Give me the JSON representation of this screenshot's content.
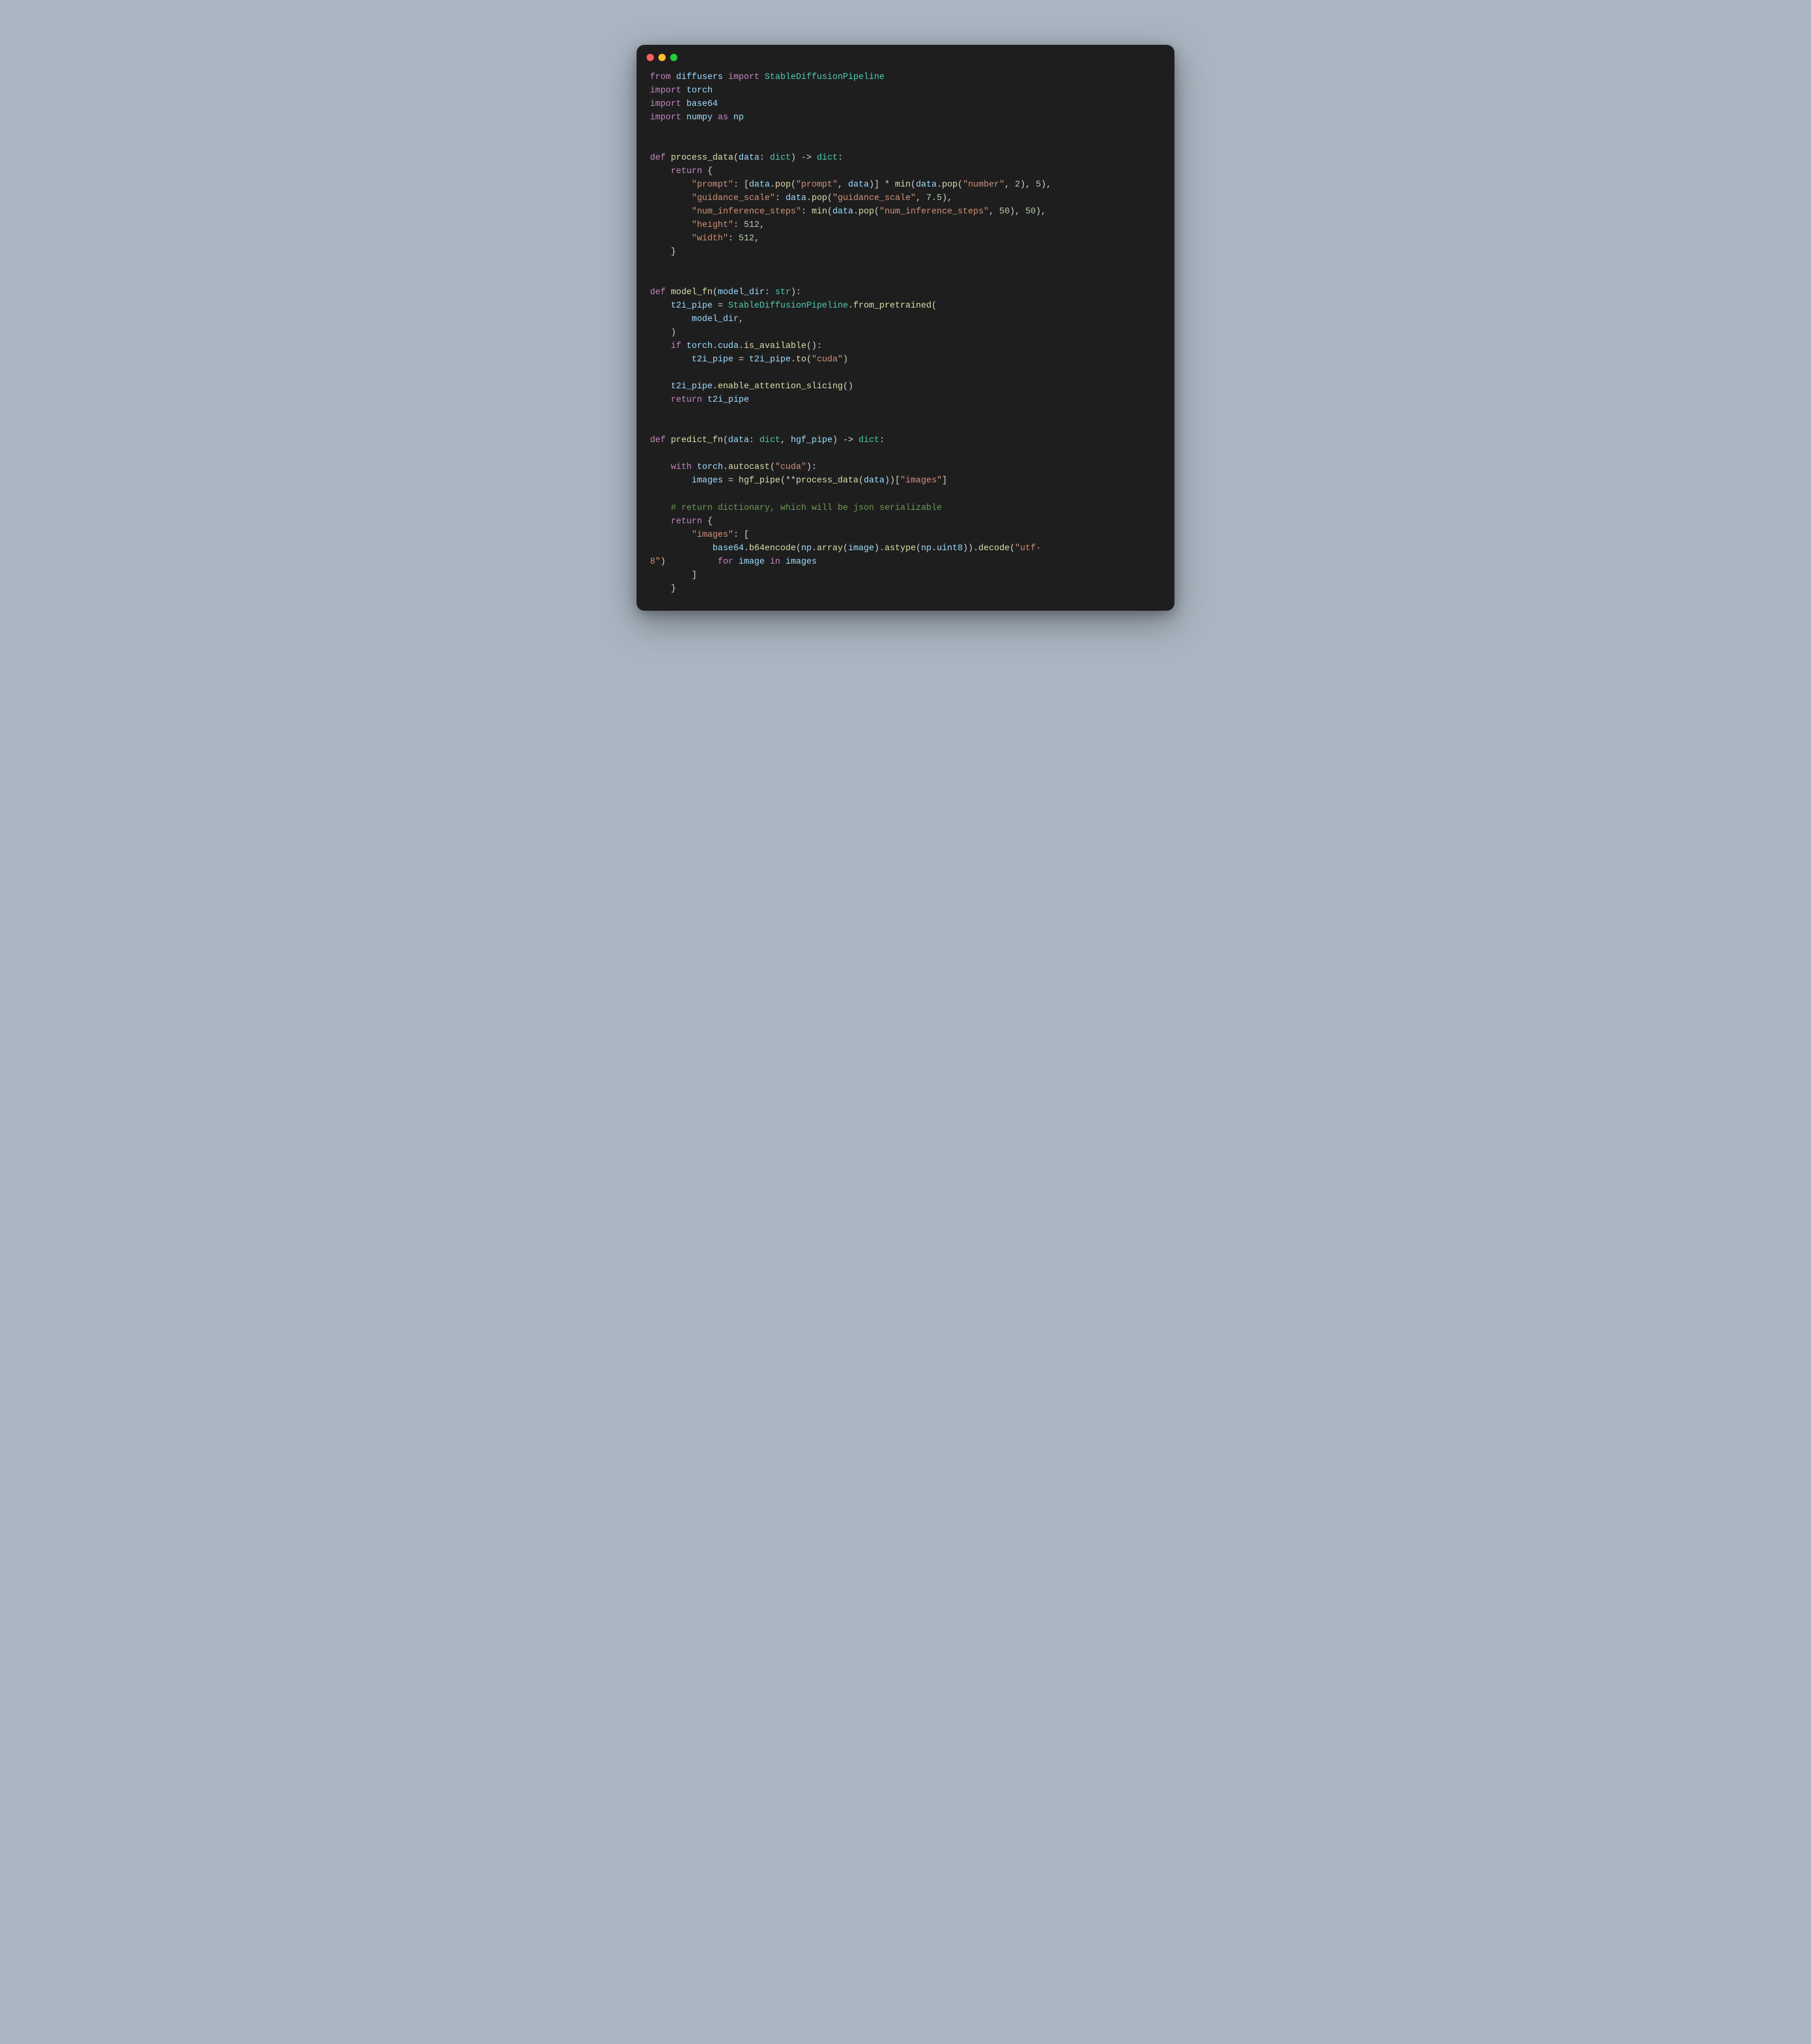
{
  "code_lines": [
    {
      "kind": "line",
      "tokens": [
        {
          "t": "from ",
          "c": "kw"
        },
        {
          "t": "diffusers ",
          "c": "var"
        },
        {
          "t": "import ",
          "c": "kw"
        },
        {
          "t": "StableDiffusionPipeline",
          "c": "cls"
        }
      ]
    },
    {
      "kind": "line",
      "tokens": [
        {
          "t": "import ",
          "c": "kw"
        },
        {
          "t": "torch",
          "c": "var"
        }
      ]
    },
    {
      "kind": "line",
      "tokens": [
        {
          "t": "import ",
          "c": "kw"
        },
        {
          "t": "base64",
          "c": "var"
        }
      ]
    },
    {
      "kind": "line",
      "tokens": [
        {
          "t": "import ",
          "c": "kw"
        },
        {
          "t": "numpy ",
          "c": "var"
        },
        {
          "t": "as ",
          "c": "kw"
        },
        {
          "t": "np",
          "c": "var"
        }
      ]
    },
    {
      "kind": "blank"
    },
    {
      "kind": "blank"
    },
    {
      "kind": "line",
      "tokens": [
        {
          "t": "def ",
          "c": "kw"
        },
        {
          "t": "process_data",
          "c": "fn"
        },
        {
          "t": "(",
          "c": "op"
        },
        {
          "t": "data",
          "c": "var"
        },
        {
          "t": ": ",
          "c": "op"
        },
        {
          "t": "dict",
          "c": "cls"
        },
        {
          "t": ") -> ",
          "c": "op"
        },
        {
          "t": "dict",
          "c": "cls"
        },
        {
          "t": ":",
          "c": "op"
        }
      ]
    },
    {
      "kind": "line",
      "tokens": [
        {
          "t": "    ",
          "c": "op"
        },
        {
          "t": "return ",
          "c": "kw"
        },
        {
          "t": "{",
          "c": "op"
        }
      ]
    },
    {
      "kind": "line",
      "tokens": [
        {
          "t": "        ",
          "c": "op"
        },
        {
          "t": "\"prompt\"",
          "c": "str"
        },
        {
          "t": ": [",
          "c": "op"
        },
        {
          "t": "data",
          "c": "var"
        },
        {
          "t": ".",
          "c": "op"
        },
        {
          "t": "pop",
          "c": "fn"
        },
        {
          "t": "(",
          "c": "op"
        },
        {
          "t": "\"prompt\"",
          "c": "str"
        },
        {
          "t": ", ",
          "c": "op"
        },
        {
          "t": "data",
          "c": "var"
        },
        {
          "t": ")] * ",
          "c": "op"
        },
        {
          "t": "min",
          "c": "fn"
        },
        {
          "t": "(",
          "c": "op"
        },
        {
          "t": "data",
          "c": "var"
        },
        {
          "t": ".",
          "c": "op"
        },
        {
          "t": "pop",
          "c": "fn"
        },
        {
          "t": "(",
          "c": "op"
        },
        {
          "t": "\"number\"",
          "c": "str"
        },
        {
          "t": ", ",
          "c": "op"
        },
        {
          "t": "2",
          "c": "num"
        },
        {
          "t": "), ",
          "c": "op"
        },
        {
          "t": "5",
          "c": "num"
        },
        {
          "t": "),",
          "c": "op"
        }
      ]
    },
    {
      "kind": "line",
      "tokens": [
        {
          "t": "        ",
          "c": "op"
        },
        {
          "t": "\"guidance_scale\"",
          "c": "str"
        },
        {
          "t": ": ",
          "c": "op"
        },
        {
          "t": "data",
          "c": "var"
        },
        {
          "t": ".",
          "c": "op"
        },
        {
          "t": "pop",
          "c": "fn"
        },
        {
          "t": "(",
          "c": "op"
        },
        {
          "t": "\"guidance_scale\"",
          "c": "str"
        },
        {
          "t": ", ",
          "c": "op"
        },
        {
          "t": "7.5",
          "c": "num"
        },
        {
          "t": "),",
          "c": "op"
        }
      ]
    },
    {
      "kind": "line",
      "tokens": [
        {
          "t": "        ",
          "c": "op"
        },
        {
          "t": "\"num_inference_steps\"",
          "c": "str"
        },
        {
          "t": ": ",
          "c": "op"
        },
        {
          "t": "min",
          "c": "fn"
        },
        {
          "t": "(",
          "c": "op"
        },
        {
          "t": "data",
          "c": "var"
        },
        {
          "t": ".",
          "c": "op"
        },
        {
          "t": "pop",
          "c": "fn"
        },
        {
          "t": "(",
          "c": "op"
        },
        {
          "t": "\"num_inference_steps\"",
          "c": "str"
        },
        {
          "t": ", ",
          "c": "op"
        },
        {
          "t": "50",
          "c": "num"
        },
        {
          "t": "), ",
          "c": "op"
        },
        {
          "t": "50",
          "c": "num"
        },
        {
          "t": "),",
          "c": "op"
        }
      ]
    },
    {
      "kind": "line",
      "tokens": [
        {
          "t": "        ",
          "c": "op"
        },
        {
          "t": "\"height\"",
          "c": "str"
        },
        {
          "t": ": ",
          "c": "op"
        },
        {
          "t": "512",
          "c": "num"
        },
        {
          "t": ",",
          "c": "op"
        }
      ]
    },
    {
      "kind": "line",
      "tokens": [
        {
          "t": "        ",
          "c": "op"
        },
        {
          "t": "\"width\"",
          "c": "str"
        },
        {
          "t": ": ",
          "c": "op"
        },
        {
          "t": "512",
          "c": "num"
        },
        {
          "t": ",",
          "c": "op"
        }
      ]
    },
    {
      "kind": "line",
      "tokens": [
        {
          "t": "    }",
          "c": "op"
        }
      ]
    },
    {
      "kind": "blank"
    },
    {
      "kind": "blank"
    },
    {
      "kind": "line",
      "tokens": [
        {
          "t": "def ",
          "c": "kw"
        },
        {
          "t": "model_fn",
          "c": "fn"
        },
        {
          "t": "(",
          "c": "op"
        },
        {
          "t": "model_dir",
          "c": "var"
        },
        {
          "t": ": ",
          "c": "op"
        },
        {
          "t": "str",
          "c": "cls"
        },
        {
          "t": "):",
          "c": "op"
        }
      ]
    },
    {
      "kind": "line",
      "tokens": [
        {
          "t": "    ",
          "c": "op"
        },
        {
          "t": "t2i_pipe",
          "c": "var"
        },
        {
          "t": " = ",
          "c": "op"
        },
        {
          "t": "StableDiffusionPipeline",
          "c": "cls"
        },
        {
          "t": ".",
          "c": "op"
        },
        {
          "t": "from_pretrained",
          "c": "fn"
        },
        {
          "t": "(",
          "c": "op"
        }
      ]
    },
    {
      "kind": "line",
      "tokens": [
        {
          "t": "        ",
          "c": "op"
        },
        {
          "t": "model_dir",
          "c": "var"
        },
        {
          "t": ",",
          "c": "op"
        }
      ]
    },
    {
      "kind": "line",
      "tokens": [
        {
          "t": "    )",
          "c": "op"
        }
      ]
    },
    {
      "kind": "line",
      "tokens": [
        {
          "t": "    ",
          "c": "op"
        },
        {
          "t": "if ",
          "c": "kw"
        },
        {
          "t": "torch",
          "c": "var"
        },
        {
          "t": ".",
          "c": "op"
        },
        {
          "t": "cuda",
          "c": "var"
        },
        {
          "t": ".",
          "c": "op"
        },
        {
          "t": "is_available",
          "c": "fn"
        },
        {
          "t": "():",
          "c": "op"
        }
      ]
    },
    {
      "kind": "line",
      "tokens": [
        {
          "t": "        ",
          "c": "op"
        },
        {
          "t": "t2i_pipe",
          "c": "var"
        },
        {
          "t": " = ",
          "c": "op"
        },
        {
          "t": "t2i_pipe",
          "c": "var"
        },
        {
          "t": ".",
          "c": "op"
        },
        {
          "t": "to",
          "c": "fn"
        },
        {
          "t": "(",
          "c": "op"
        },
        {
          "t": "\"cuda\"",
          "c": "str"
        },
        {
          "t": ")",
          "c": "op"
        }
      ]
    },
    {
      "kind": "blank"
    },
    {
      "kind": "line",
      "tokens": [
        {
          "t": "    ",
          "c": "op"
        },
        {
          "t": "t2i_pipe",
          "c": "var"
        },
        {
          "t": ".",
          "c": "op"
        },
        {
          "t": "enable_attention_slicing",
          "c": "fn"
        },
        {
          "t": "()",
          "c": "op"
        }
      ]
    },
    {
      "kind": "line",
      "tokens": [
        {
          "t": "    ",
          "c": "op"
        },
        {
          "t": "return ",
          "c": "kw"
        },
        {
          "t": "t2i_pipe",
          "c": "var"
        }
      ]
    },
    {
      "kind": "blank"
    },
    {
      "kind": "blank"
    },
    {
      "kind": "line",
      "tokens": [
        {
          "t": "def ",
          "c": "kw"
        },
        {
          "t": "predict_fn",
          "c": "fn"
        },
        {
          "t": "(",
          "c": "op"
        },
        {
          "t": "data",
          "c": "var"
        },
        {
          "t": ": ",
          "c": "op"
        },
        {
          "t": "dict",
          "c": "cls"
        },
        {
          "t": ", ",
          "c": "op"
        },
        {
          "t": "hgf_pipe",
          "c": "var"
        },
        {
          "t": ") -> ",
          "c": "op"
        },
        {
          "t": "dict",
          "c": "cls"
        },
        {
          "t": ":",
          "c": "op"
        }
      ]
    },
    {
      "kind": "blank"
    },
    {
      "kind": "line",
      "tokens": [
        {
          "t": "    ",
          "c": "op"
        },
        {
          "t": "with ",
          "c": "kw"
        },
        {
          "t": "torch",
          "c": "var"
        },
        {
          "t": ".",
          "c": "op"
        },
        {
          "t": "autocast",
          "c": "fn"
        },
        {
          "t": "(",
          "c": "op"
        },
        {
          "t": "\"cuda\"",
          "c": "str"
        },
        {
          "t": "):",
          "c": "op"
        }
      ]
    },
    {
      "kind": "line",
      "tokens": [
        {
          "t": "        ",
          "c": "op"
        },
        {
          "t": "images",
          "c": "var"
        },
        {
          "t": " = ",
          "c": "op"
        },
        {
          "t": "hgf_pipe",
          "c": "fn"
        },
        {
          "t": "(**",
          "c": "op"
        },
        {
          "t": "process_data",
          "c": "fn"
        },
        {
          "t": "(",
          "c": "op"
        },
        {
          "t": "data",
          "c": "var"
        },
        {
          "t": "))[",
          "c": "op"
        },
        {
          "t": "\"images\"",
          "c": "str"
        },
        {
          "t": "]",
          "c": "op"
        }
      ]
    },
    {
      "kind": "blank"
    },
    {
      "kind": "line",
      "tokens": [
        {
          "t": "    ",
          "c": "op"
        },
        {
          "t": "# return dictionary, which will be json serializable",
          "c": "cm"
        }
      ]
    },
    {
      "kind": "line",
      "tokens": [
        {
          "t": "    ",
          "c": "op"
        },
        {
          "t": "return ",
          "c": "kw"
        },
        {
          "t": "{",
          "c": "op"
        }
      ]
    },
    {
      "kind": "line",
      "tokens": [
        {
          "t": "        ",
          "c": "op"
        },
        {
          "t": "\"images\"",
          "c": "str"
        },
        {
          "t": ": [",
          "c": "op"
        }
      ]
    },
    {
      "kind": "line",
      "tokens": [
        {
          "t": "            ",
          "c": "op"
        },
        {
          "t": "base64",
          "c": "var"
        },
        {
          "t": ".",
          "c": "op"
        },
        {
          "t": "b64encode",
          "c": "fn"
        },
        {
          "t": "(",
          "c": "op"
        },
        {
          "t": "np",
          "c": "var"
        },
        {
          "t": ".",
          "c": "op"
        },
        {
          "t": "array",
          "c": "fn"
        },
        {
          "t": "(",
          "c": "op"
        },
        {
          "t": "image",
          "c": "var"
        },
        {
          "t": ").",
          "c": "op"
        },
        {
          "t": "astype",
          "c": "fn"
        },
        {
          "t": "(",
          "c": "op"
        },
        {
          "t": "np",
          "c": "var"
        },
        {
          "t": ".",
          "c": "op"
        },
        {
          "t": "uint8",
          "c": "var"
        },
        {
          "t": ")).",
          "c": "op"
        },
        {
          "t": "decode",
          "c": "fn"
        },
        {
          "t": "(",
          "c": "op"
        },
        {
          "t": "\"utf-",
          "c": "str"
        }
      ]
    },
    {
      "kind": "line",
      "tokens": [
        {
          "t": "8\"",
          "c": "str"
        },
        {
          "t": ")          ",
          "c": "op"
        },
        {
          "t": "for ",
          "c": "kw"
        },
        {
          "t": "image ",
          "c": "var"
        },
        {
          "t": "in ",
          "c": "kw"
        },
        {
          "t": "images",
          "c": "var"
        }
      ]
    },
    {
      "kind": "line",
      "tokens": [
        {
          "t": "        ]",
          "c": "op"
        }
      ]
    },
    {
      "kind": "line",
      "tokens": [
        {
          "t": "    }",
          "c": "op"
        }
      ]
    }
  ]
}
